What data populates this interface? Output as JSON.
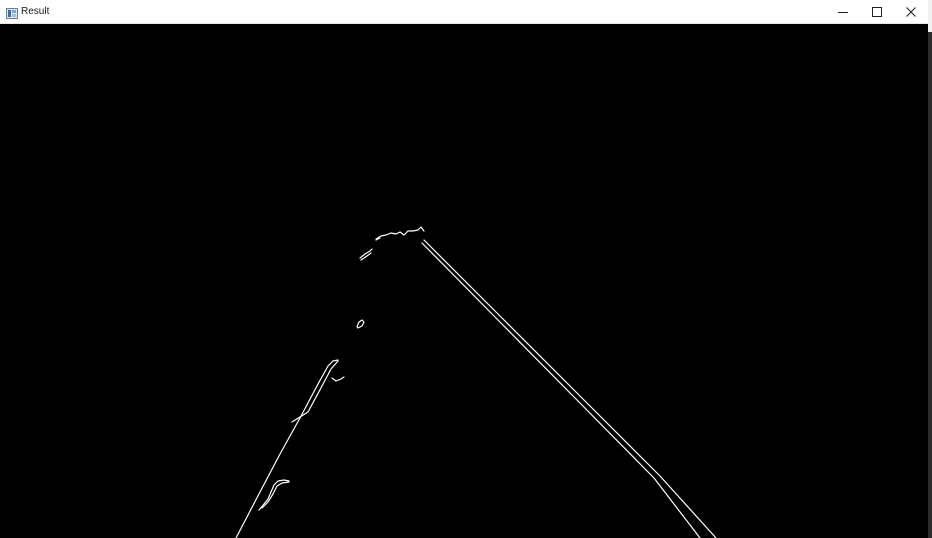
{
  "window": {
    "title": "Result",
    "icon": "opencv-window-icon",
    "controls": {
      "minimize_icon": "minimize-icon",
      "maximize_icon": "maximize-icon",
      "close_icon": "close-icon"
    }
  },
  "image": {
    "description_type": "canny-edge-output",
    "background_color": "#000000",
    "edge_color": "#ffffff"
  }
}
